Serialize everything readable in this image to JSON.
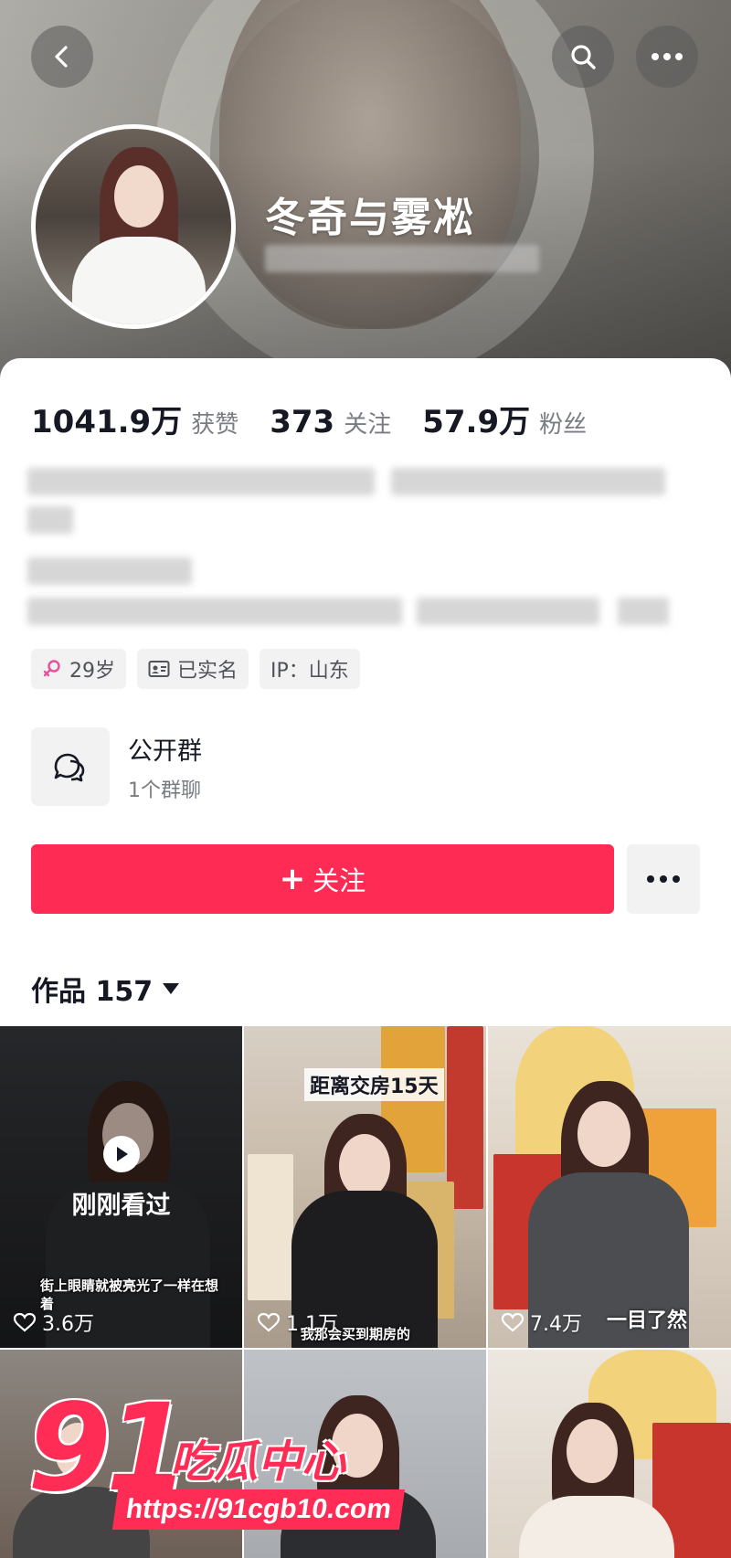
{
  "profile": {
    "nickname": "冬奇与雾凇"
  },
  "stats": [
    {
      "value": "1041.9万",
      "label": "获赞"
    },
    {
      "value": "373",
      "label": "关注"
    },
    {
      "value": "57.9万",
      "label": "粉丝"
    }
  ],
  "tags": {
    "age": "29岁",
    "verified": "已实名",
    "ip": "IP：山东"
  },
  "group": {
    "title": "公开群",
    "subtitle": "1个群聊"
  },
  "actions": {
    "follow_label": "关注",
    "follow_plus": "+"
  },
  "works": {
    "label": "作品 157"
  },
  "videos": [
    {
      "badge": "刚刚看过",
      "likes": "3.6万",
      "caption": "街上眼睛就被亮光了一样在想着"
    },
    {
      "banner": "距离交房15天",
      "likes": "1.1万",
      "caption": "我那会买到期房的"
    },
    {
      "likes": "7.4万",
      "caption": "一目了然"
    }
  ],
  "watermark": {
    "number": "91",
    "brand": "吃瓜中心",
    "url": "https://91cgb10.com"
  },
  "colors": {
    "accent": "#fe2c55",
    "watermark": "#ff2d55",
    "tag_bg": "#f2f2f3",
    "muted_text": "#7a7c83"
  },
  "icons": [
    "back-arrow-icon",
    "search-icon",
    "more-dots-icon",
    "female-icon",
    "id-card-icon",
    "group-chat-icon",
    "play-icon",
    "heart-icon",
    "caret-down-icon"
  ]
}
